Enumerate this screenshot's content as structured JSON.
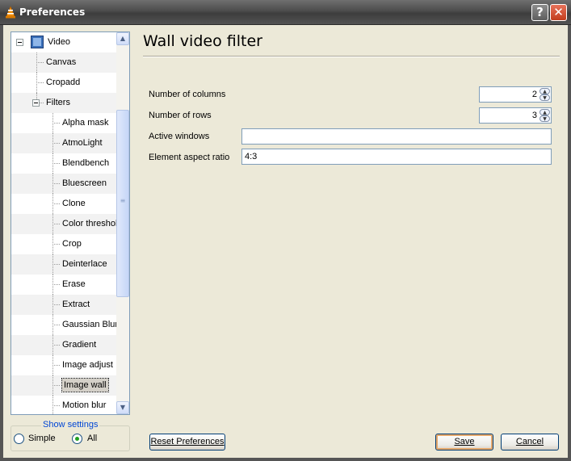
{
  "window": {
    "title": "Preferences",
    "help_label": "?",
    "close_label": "✕"
  },
  "tree": {
    "items": [
      {
        "label": "Video",
        "level": 0
      },
      {
        "label": "Canvas",
        "level": 1
      },
      {
        "label": "Cropadd",
        "level": 1
      },
      {
        "label": "Filters",
        "level": 1
      },
      {
        "label": "Alpha mask",
        "level": 2
      },
      {
        "label": "AtmoLight",
        "level": 2
      },
      {
        "label": "Blendbench",
        "level": 2
      },
      {
        "label": "Bluescreen",
        "level": 2
      },
      {
        "label": "Clone",
        "level": 2
      },
      {
        "label": "Color threshol",
        "level": 2
      },
      {
        "label": "Crop",
        "level": 2
      },
      {
        "label": "Deinterlace",
        "level": 2
      },
      {
        "label": "Erase",
        "level": 2
      },
      {
        "label": "Extract",
        "level": 2
      },
      {
        "label": "Gaussian Blur",
        "level": 2
      },
      {
        "label": "Gradient",
        "level": 2
      },
      {
        "label": "Image adjust",
        "level": 2
      },
      {
        "label": "Image wall",
        "level": 2
      },
      {
        "label": "Motion blur",
        "level": 2
      }
    ],
    "selected": "Image wall"
  },
  "show_settings": {
    "title": "Show settings",
    "simple_label": "Simple",
    "all_label": "All",
    "selected": "All"
  },
  "panel": {
    "title": "Wall video filter",
    "fields": {
      "columns_label": "Number of columns",
      "columns_value": "2",
      "rows_label": "Number of rows",
      "rows_value": "3",
      "active_windows_label": "Active windows",
      "active_windows_value": "",
      "aspect_label": "Element aspect ratio",
      "aspect_value": "4:3"
    }
  },
  "buttons": {
    "reset": "Reset Preferences",
    "save": "Save",
    "cancel": "Cancel"
  },
  "colors": {
    "group_title": "#0046d5",
    "selected_bg": "#d4d0c8",
    "close_button": "#c23d1d"
  }
}
